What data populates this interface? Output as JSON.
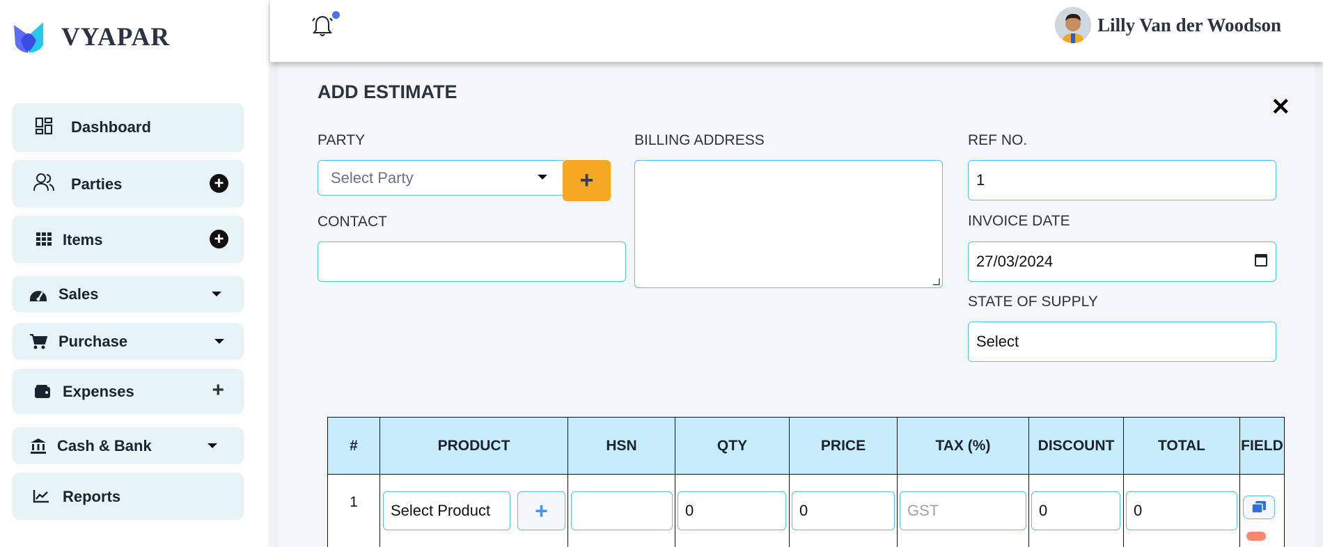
{
  "brand": {
    "name": "VYAPAR"
  },
  "sidebar": {
    "items": [
      {
        "label": "Dashboard",
        "icon": "dashboard-icon",
        "action": "none"
      },
      {
        "label": "Parties",
        "icon": "users-icon",
        "action": "circle-plus"
      },
      {
        "label": "Items",
        "icon": "grid-icon",
        "action": "circle-plus"
      },
      {
        "label": "Sales",
        "icon": "speedometer-icon",
        "action": "caret"
      },
      {
        "label": "Purchase",
        "icon": "cart-icon",
        "action": "caret"
      },
      {
        "label": "Expenses",
        "icon": "wallet-icon",
        "action": "plus"
      },
      {
        "label": "Cash & Bank",
        "icon": "bank-icon",
        "action": "caret"
      },
      {
        "label": "Reports",
        "icon": "chart-line-icon",
        "action": "none"
      }
    ]
  },
  "header": {
    "user_name": "Lilly Van der Woodson",
    "colors": {
      "notification_dot": "#4f6ff2"
    }
  },
  "form": {
    "title": "ADD ESTIMATE",
    "party": {
      "label": "PARTY",
      "placeholder": "Select Party"
    },
    "contact": {
      "label": "CONTACT",
      "value": ""
    },
    "billing_address": {
      "label": "BILLING ADDRESS",
      "value": ""
    },
    "ref_no": {
      "label": "REF NO.",
      "value": "1"
    },
    "invoice_date": {
      "label": "INVOICE DATE",
      "value": "27/03/2024"
    },
    "state_of_supply": {
      "label": "STATE OF SUPPLY",
      "value": "Select"
    },
    "add_party_label": "+",
    "accent_colors": {
      "orange": "#f7a823",
      "border": "#54c3e6",
      "table_header": "#c7ecfb"
    }
  },
  "table": {
    "headers": [
      "#",
      "PRODUCT",
      "HSN",
      "QTY",
      "PRICE",
      "TAX (%)",
      "DISCOUNT",
      "TOTAL",
      "FIELD"
    ],
    "rows": [
      {
        "num": "1",
        "product": "Select Product",
        "add_product_label": "+",
        "hsn": "",
        "qty": "0",
        "price": "0",
        "tax_placeholder": "GST",
        "discount": "0",
        "total": "0"
      }
    ]
  }
}
